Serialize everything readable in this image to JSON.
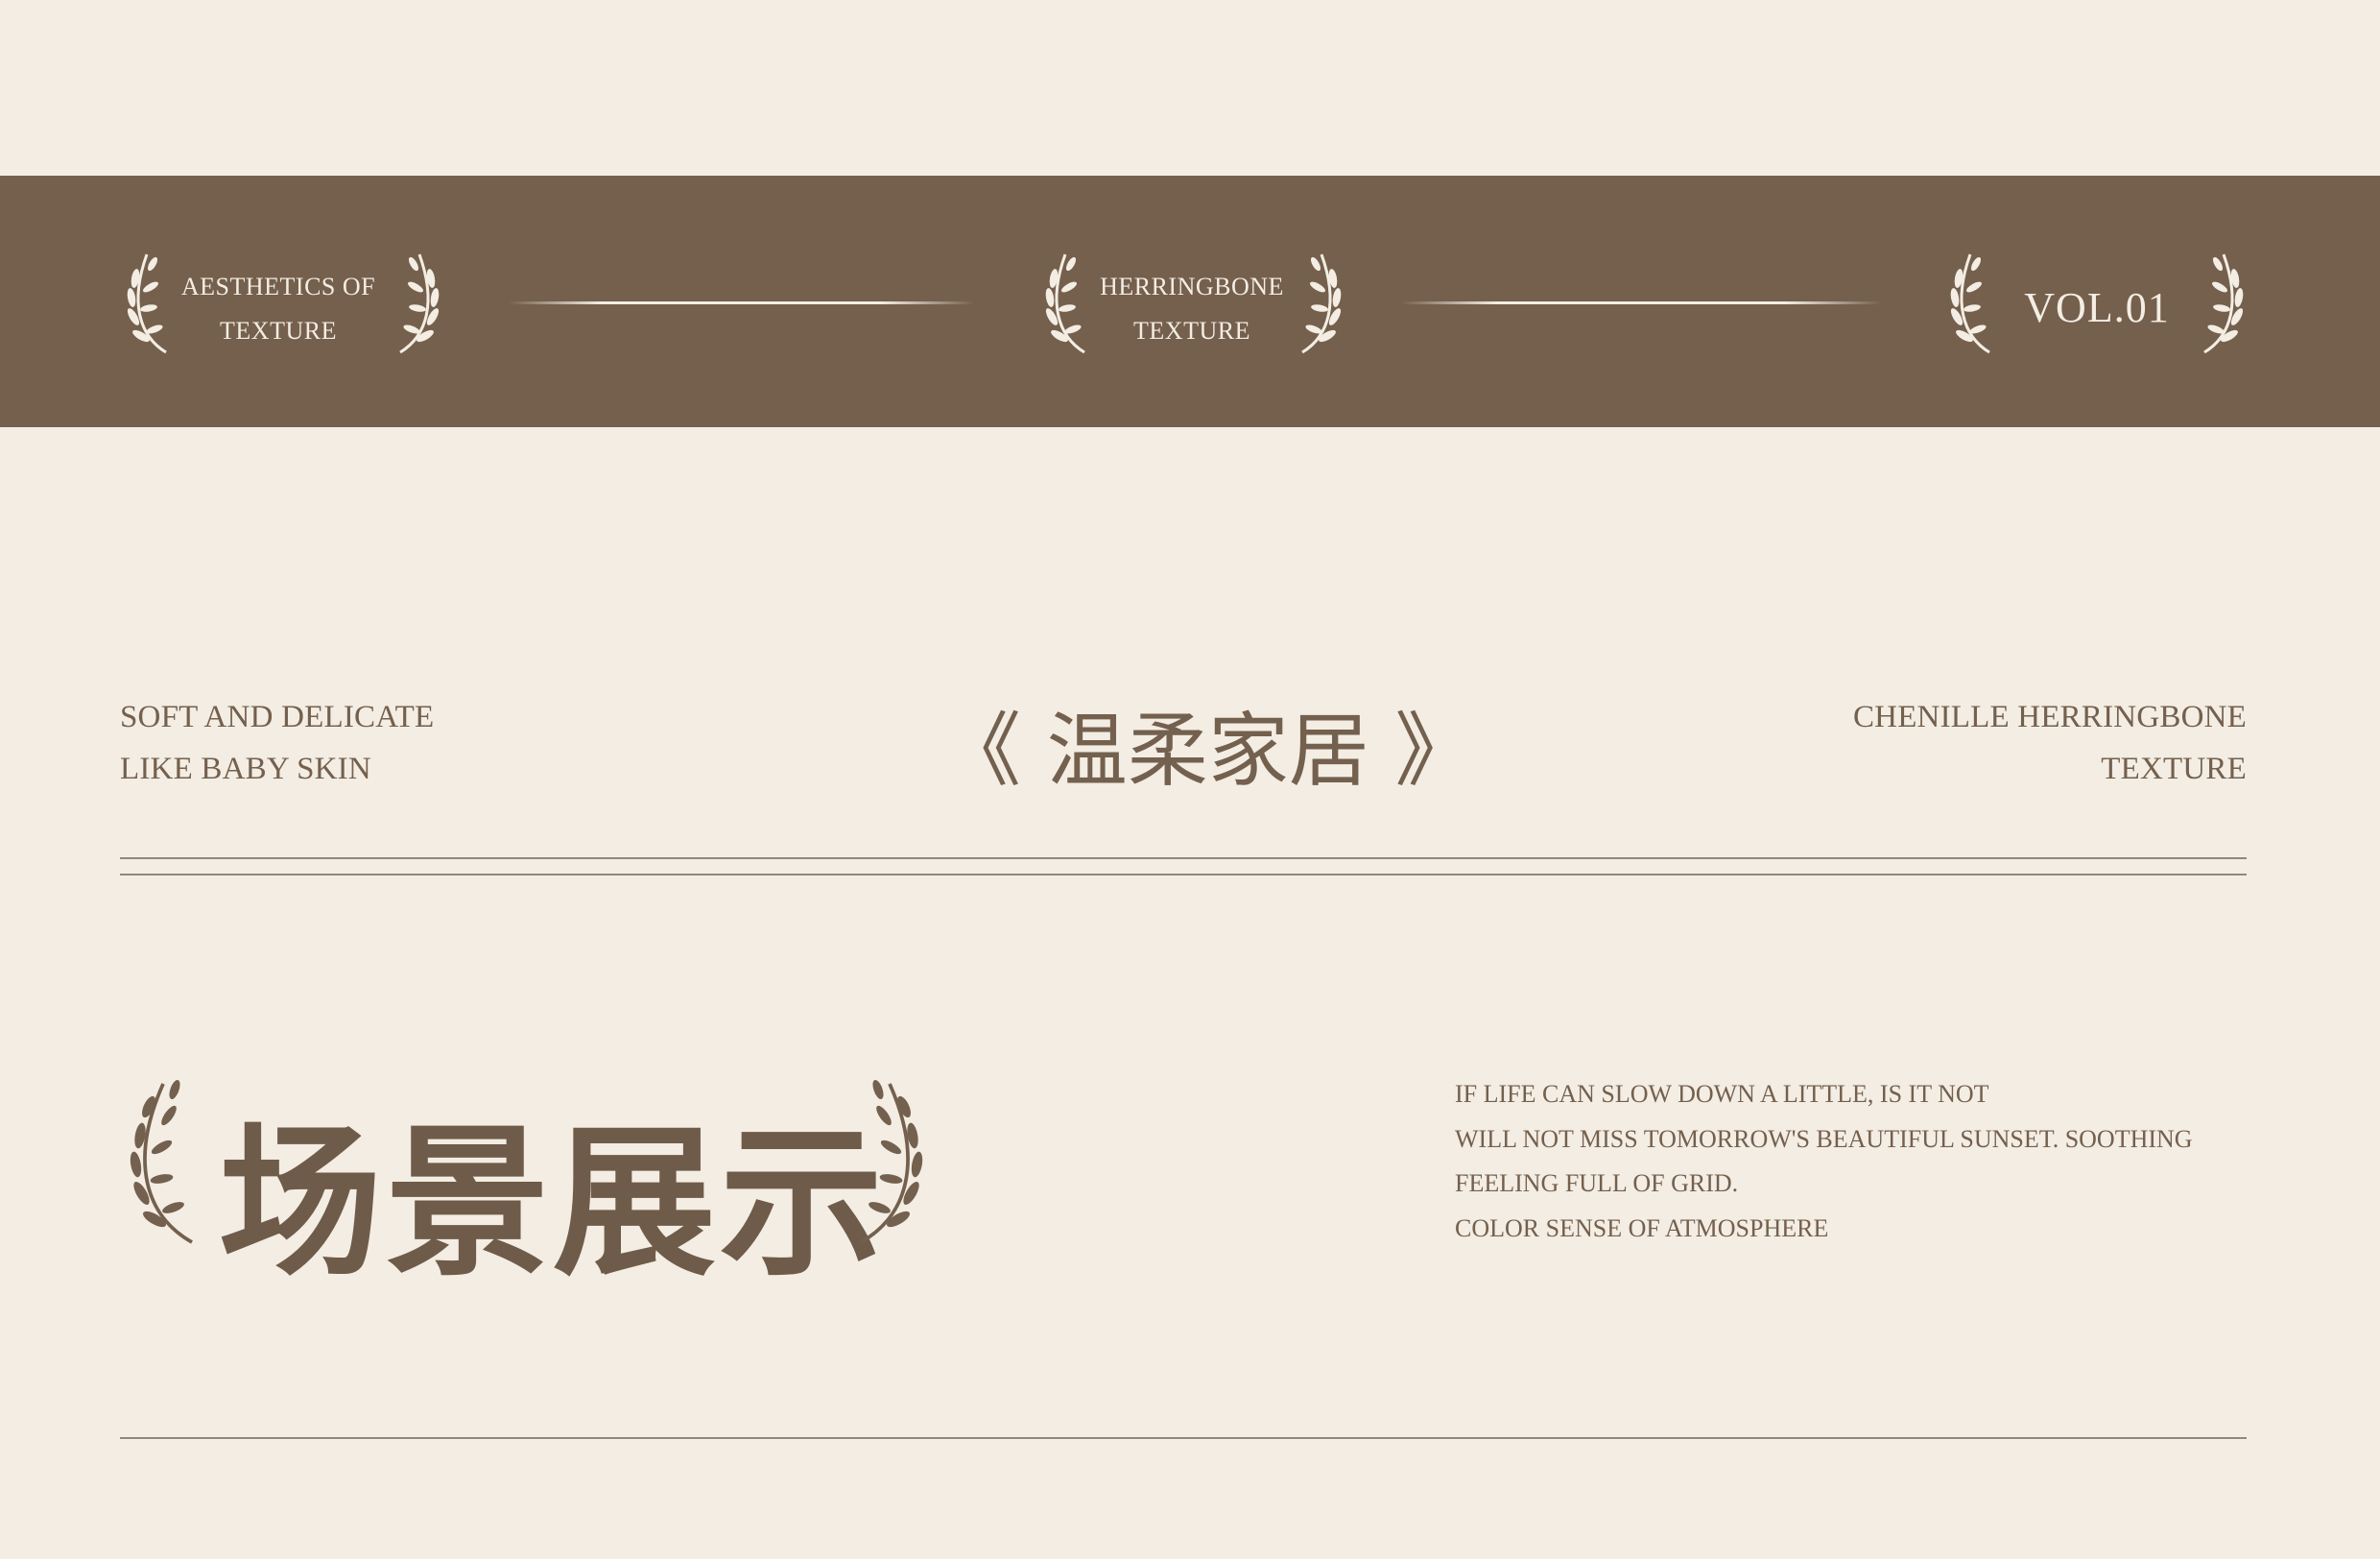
{
  "colors": {
    "background": "#F3EDE3",
    "band": "#75604D",
    "text": "#74604E",
    "rule": "#8F887F"
  },
  "band": {
    "left_label_line1": "AESTHETICS OF",
    "left_label_line2": "TEXTURE",
    "center_label_line1": "HERRINGBONE",
    "center_label_line2": "TEXTURE",
    "right_label": "VOL.01"
  },
  "row": {
    "left_line1": "SOFT AND DELICATE",
    "left_line2": "LIKE BABY SKIN",
    "title": "《 温柔家居 》",
    "right_line1": "CHENILLE HERRINGBONE",
    "right_line2": "TEXTURE"
  },
  "section": {
    "title": "场景展示",
    "paragraph_lines": [
      "IF LIFE CAN SLOW DOWN A LITTLE, IS IT NOT",
      "WILL NOT MISS TOMORROW'S BEAUTIFUL SUNSET. SOOTHING",
      "FEELING FULL OF GRID.",
      "COLOR SENSE OF ATMOSPHERE"
    ]
  },
  "icons": [
    "laurel-wreath-icon"
  ]
}
